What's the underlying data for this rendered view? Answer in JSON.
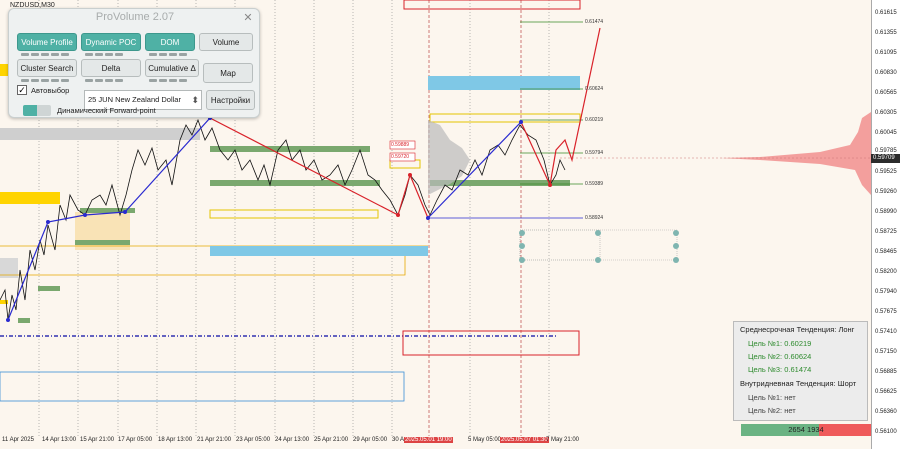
{
  "chart_header": "NZDUSD,M30",
  "panel": {
    "title": "ProVolume 2.07",
    "close": "✕",
    "buttons": {
      "volume_profile": "Volume Profile",
      "dynamic_poc": "Dynamic POC",
      "dom": "DOM",
      "volume": "Volume",
      "cluster_search": "Cluster Search",
      "delta": "Delta",
      "cumulative_delta": "Cumulative Δ",
      "map": "Map",
      "settings": "Настройки"
    },
    "auto_select_label": "Автовыбор",
    "auto_select_checked": "✓",
    "instrument": "25 JUN New Zealand Dollar",
    "forward_point_label": "Динамический Forward-point"
  },
  "price_axis": [
    "0.61615",
    "0.61355",
    "0.61095",
    "0.60830",
    "0.60565",
    "0.60305",
    "0.60045",
    "0.59785",
    "0.59525",
    "0.59260",
    "0.58990",
    "0.58725",
    "0.58465",
    "0.58200",
    "0.57940",
    "0.57675",
    "0.57410",
    "0.57150",
    "0.56885",
    "0.56625",
    "0.56360",
    "0.56100"
  ],
  "current_price": "0.59709",
  "levels": [
    "0.61474",
    "0.60624",
    "0.60219",
    "0.59794",
    "0.59389",
    "0.58924"
  ],
  "box_labels": [
    "0.59889",
    "0.59720"
  ],
  "time_axis": [
    "11 Apr 2025",
    "14 Apr 13:00",
    "15 Apr 21:00",
    "17 Apr 05:00",
    "18 Apr 13:00",
    "21 Apr 21:00",
    "23 Apr 05:00",
    "24 Apr 13:00",
    "25 Apr 21:00",
    "29 Apr 05:00",
    "30 A",
    "2025.05.01 19:00",
    "5 May 05:00",
    "2025.05.07 01:30",
    "7 May 21:00"
  ],
  "info": {
    "medium_trend": "Среднесрочная Тенденция: Лонг",
    "target1": "Цель №1: 0.60219",
    "target2": "Цель №2: 0.60624",
    "target3": "Цель №3: 0.61474",
    "intraday_trend": "Внутридневная Тенденция: Шорт",
    "intra_target1": "Цель №1: нет",
    "intra_target2": "Цель №2: нет"
  },
  "volume_bar": "2654 1934",
  "colors": {
    "teal": "#4fb1a5",
    "accent_red": "#d9222a",
    "blue": "#2a2ad0",
    "green": "#2e8b2e"
  }
}
